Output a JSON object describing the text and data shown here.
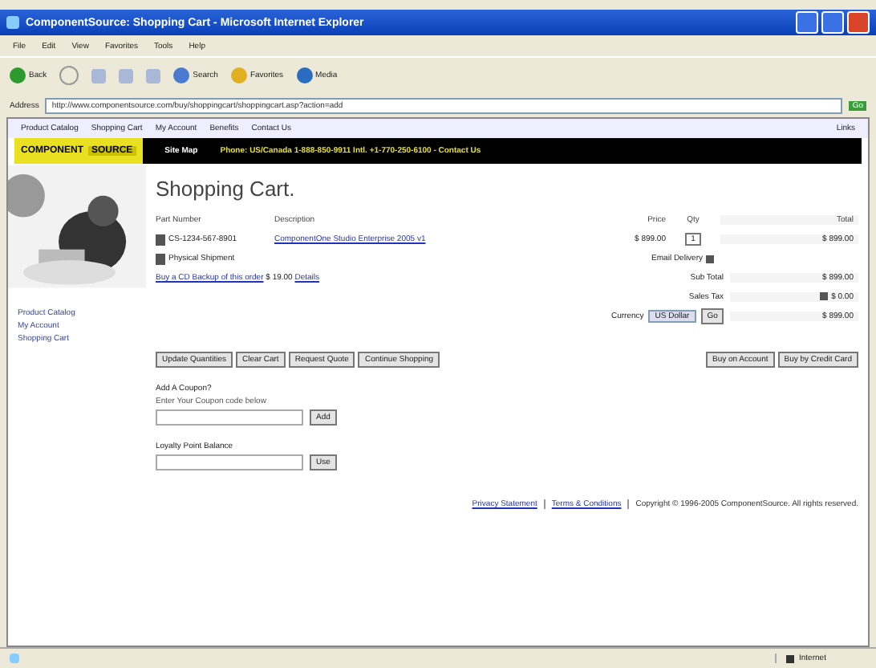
{
  "window": {
    "title": "ComponentSource: Shopping Cart - Microsoft Internet Explorer"
  },
  "menu": [
    "File",
    "Edit",
    "View",
    "Favorites",
    "Tools",
    "Help"
  ],
  "toolbar": [
    {
      "label": "Back"
    },
    {
      "label": "Search"
    },
    {
      "label": "Favorites"
    },
    {
      "label": "Media"
    }
  ],
  "address": {
    "label": "Address",
    "value": "http://www.componentsource.com/buy/shoppingcart/shoppingcart.asp?action=add",
    "go": "Go"
  },
  "links_bar": {
    "items": [
      "Product Catalog",
      "Shopping Cart",
      "My Account",
      "Benefits",
      "Contact Us"
    ],
    "right": "Links"
  },
  "banner": {
    "logo": "COMPONENT",
    "logo_tag": "SOURCE",
    "items": [
      "Site Map",
      "Phone: US/Canada 1-888-850-9911 Intl. +1-770-250-6100 - Contact Us"
    ]
  },
  "sidebar": {
    "items": [
      "Product Catalog",
      "My Account",
      "Shopping Cart"
    ]
  },
  "cart": {
    "title": "Shopping Cart.",
    "columns": [
      "Part Number",
      "Description",
      "Price",
      "Qty",
      "Total"
    ],
    "item": {
      "part": "CS-1234-567-8901",
      "description": "ComponentOne Studio Enterprise 2005 v1",
      "price": "$ 899.00",
      "qty": "1",
      "total": "$ 899.00"
    },
    "note": "Physical Shipment",
    "delivery": "Email Delivery",
    "insurance": {
      "link": "Buy a CD Backup of this order",
      "price": "$ 19.00",
      "more": "Details"
    },
    "subtotal": {
      "label": "Sub Total",
      "value": "$ 899.00"
    },
    "tax": {
      "label": "Sales Tax",
      "value": "$ 0.00"
    },
    "currency": {
      "label": "Currency",
      "options": [
        "US Dollar",
        "Go"
      ],
      "value": "$ 899.00"
    },
    "buttons": [
      "Update Quantities",
      "Clear Cart",
      "Request Quote",
      "Continue Shopping"
    ],
    "right_buttons": [
      "Buy on Account",
      "Buy by Credit Card"
    ],
    "coupon": {
      "title": "Add A Coupon?",
      "hint": "Enter Your Coupon code below",
      "button": "Add"
    },
    "points": {
      "title": "Loyalty Point Balance",
      "button": "Use"
    }
  },
  "footer": {
    "links": [
      "Privacy Statement",
      "Terms & Conditions"
    ],
    "copyright": "Copyright © 1996-2005 ComponentSource. All rights reserved."
  },
  "status_bar": {
    "zone": "Internet"
  }
}
